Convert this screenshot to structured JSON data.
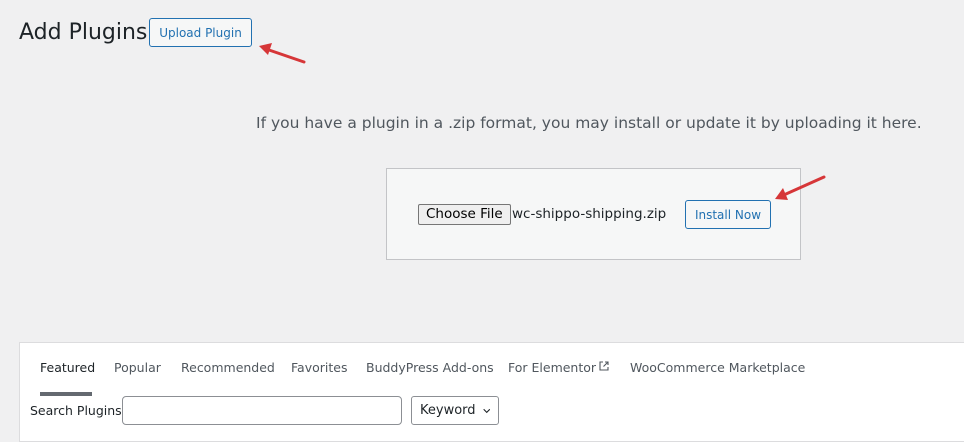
{
  "header": {
    "title": "Add Plugins",
    "upload_button_label": "Upload Plugin"
  },
  "upload": {
    "description": "If you have a plugin in a .zip format, you may install or update it by uploading it here.",
    "choose_file_label": "Choose File",
    "selected_file": "wc-shippo-shipping.zip",
    "install_button_label": "Install Now"
  },
  "filter": {
    "tabs": [
      {
        "label": "Featured",
        "current": true
      },
      {
        "label": "Popular"
      },
      {
        "label": "Recommended"
      },
      {
        "label": "Favorites"
      },
      {
        "label": "BuddyPress Add-ons"
      },
      {
        "label": "For Elementor",
        "external": true
      },
      {
        "label": "WooCommerce Marketplace"
      }
    ],
    "search_label": "Search Plugins",
    "search_value": "",
    "search_type_value": "Keyword"
  },
  "colors": {
    "accent": "#2271b1",
    "annotation_arrow": "#d63638",
    "background": "#f0f0f1"
  },
  "icons": {
    "external": "external-link-icon",
    "dropdown": "chevron-down-icon",
    "annotation": "red-arrow-annotation"
  }
}
